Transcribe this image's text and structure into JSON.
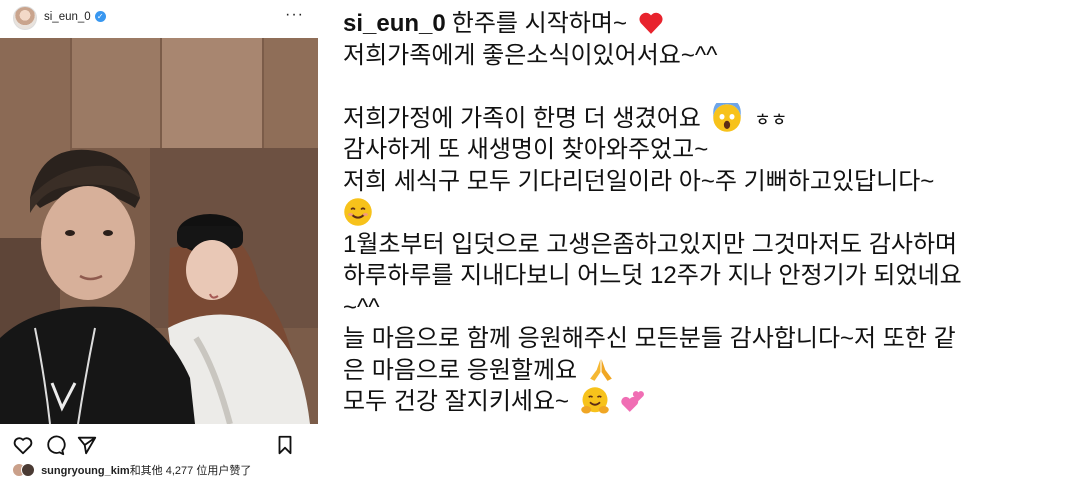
{
  "post": {
    "username": "si_eun_0",
    "verified_mark": "✓",
    "more_label": "···",
    "likes_user": "sungryoung_kim",
    "likes_text": "和其他 4,277 位用户",
    "likes_suffix": "赞了"
  },
  "caption": {
    "username": "si_eun_0",
    "lines": [
      "한주를 시작하며~",
      "저희가족에게 좋은소식이있어서요~^^",
      "",
      "저희가정에 가족이 한명 더 생겼어요",
      "ㅎㅎ",
      "감사하게 또 새생명이 찾아와주었고~",
      "저희 세식구 모두 기다리던일이라 아~주 기뻐하고있답니다~",
      "1월초부터 입덧으로 고생은좀하고있지만 그것마저도 감사하며",
      "하루하루를 지내다보니 어느덧 12주가 지나 안정기가 되었네요",
      "~^^",
      "늘 마음으로 함께 응원해주신 모든분들 감사합니다~저 또한 같",
      "은 마음으로 응원할께요",
      "모두 건강 잘지키세요~"
    ]
  },
  "icons": {
    "heart": "heart-icon",
    "comment": "comment-icon",
    "share": "share-icon",
    "bookmark": "bookmark-icon",
    "red_heart_emoji": "red-heart-emoji",
    "scream_emoji": "scream-emoji",
    "smile_emoji": "smile-emoji",
    "praying_emoji": "praying-hands-emoji",
    "hug_emoji": "hugging-face-emoji",
    "two_hearts_emoji": "two-hearts-emoji"
  },
  "colors": {
    "verified": "#3897f0",
    "text": "#111111",
    "emoji_yellow": "#f7c21b",
    "heart_red": "#e8232d",
    "pink": "#f06eb4"
  }
}
